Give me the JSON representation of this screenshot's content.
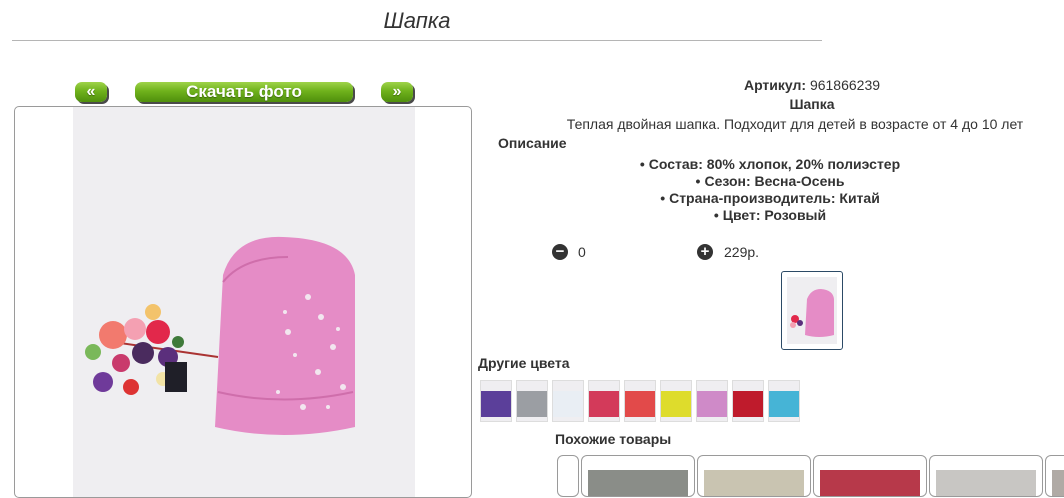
{
  "page": {
    "title": "Шапка"
  },
  "gallery": {
    "prev_label": "«",
    "download_label": "Скачать фото",
    "next_label": "»"
  },
  "product": {
    "article_label": "Артикул:",
    "article_value": "961866239",
    "name": "Шапка",
    "short_description": "Теплая двойная шапка. Подходит для детей в возрасте от 4 до 10 лет",
    "description_heading": "Описание",
    "properties": [
      "Состав: 80% хлопок, 20% полиэстер",
      "Сезон: Весна-Осень",
      "Страна-производитель: Китай",
      "Цвет: Розовый"
    ],
    "quantity": "0",
    "price": "229р.",
    "main_color": "#e58cc6"
  },
  "other_colors": {
    "heading": "Другие цвета",
    "swatches": [
      "#5b3f9a",
      "#9b9ea3",
      "#e9eef4",
      "#d33a5a",
      "#e24a4a",
      "#dedc2c",
      "#cf8ac8",
      "#bf1b2c",
      "#46b4d6"
    ]
  },
  "similar": {
    "heading": "Похожие товары"
  }
}
